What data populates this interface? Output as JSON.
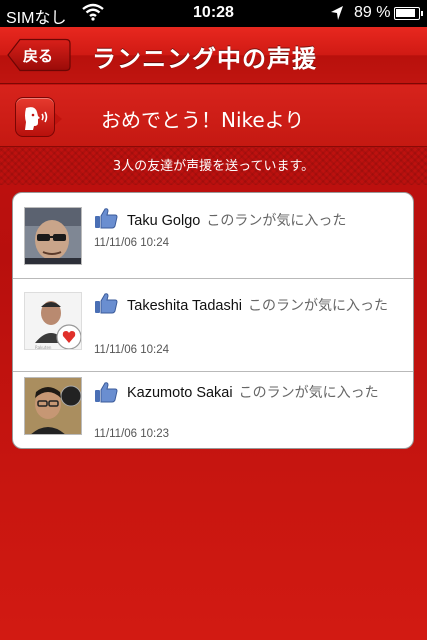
{
  "status_bar": {
    "carrier": "SIMなし",
    "time": "10:28",
    "battery": "89 %"
  },
  "nav": {
    "back_label": "戻る",
    "title": "ランニング中の声援"
  },
  "banner": {
    "title": "おめでとう！Nikeより"
  },
  "cheer_count": "3人の友達が声援を送っています。",
  "cheers": [
    {
      "name": "Taku Golgo",
      "message": "このランが気に入った",
      "timestamp": "11/11/06  10:24"
    },
    {
      "name": "Takeshita Tadashi",
      "message": "このランが気に入った",
      "timestamp": "11/11/06  10:24"
    },
    {
      "name": "Kazumoto Sakai",
      "message": "このランが気に入った",
      "timestamp": "11/11/06  10:23"
    }
  ],
  "colors": {
    "accent": "#c61412",
    "like_blue": "#4a6fb5"
  }
}
